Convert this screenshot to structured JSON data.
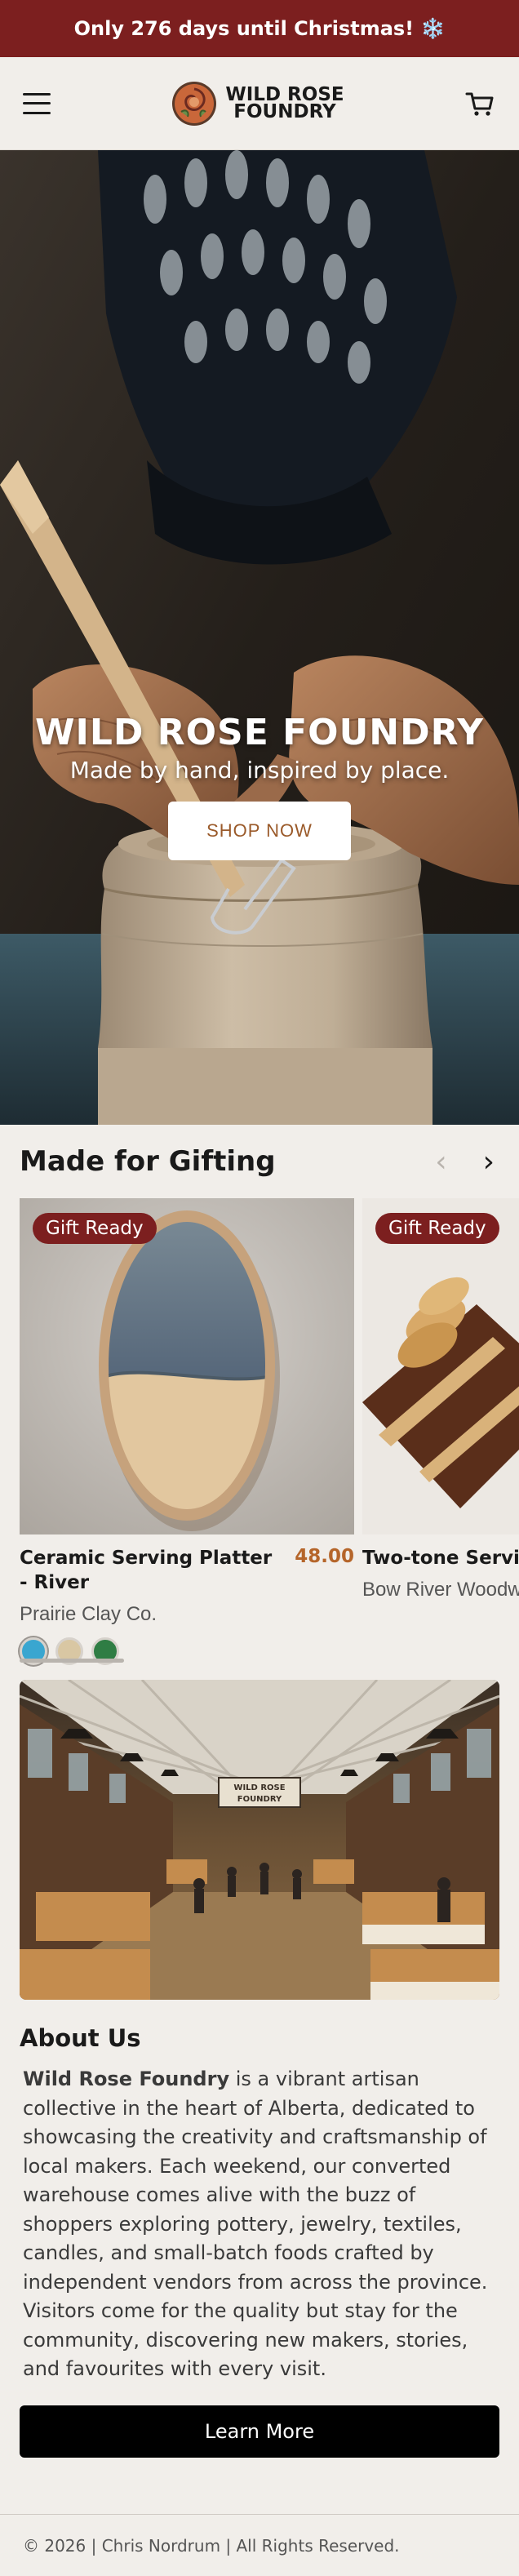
{
  "announcement": {
    "text": "Only 276 days until Christmas! ❄️"
  },
  "header": {
    "logo_line1": "WILD ROSE",
    "logo_line2": "FOUNDRY"
  },
  "hero": {
    "title": "WILD ROSE FOUNDRY",
    "subtitle": "Made by hand, inspired by place.",
    "cta": "SHOP NOW"
  },
  "gifting": {
    "title": "Made for Gifting",
    "products": [
      {
        "badge": "Gift Ready",
        "name": "Ceramic Serving Platter - River",
        "price": "48.00",
        "vendor": "Prairie Clay Co.",
        "swatches": [
          "#3aa6d0",
          "#d9c7a3",
          "#2f7d44"
        ]
      },
      {
        "badge": "Gift Ready",
        "name": "Two-tone Serving Board",
        "price": "",
        "vendor": "Bow River Woodworks"
      }
    ]
  },
  "market_image": {
    "sign_line1": "WILD ROSE",
    "sign_line2": "FOUNDRY"
  },
  "about": {
    "title": "About Us",
    "brand": "Wild Rose Foundry",
    "body": " is a vibrant artisan collective in the heart of Alberta, dedicated to showcasing the creativity and craftsmanship of local makers. Each weekend, our converted warehouse comes alive with the buzz of shoppers exploring pottery, jewelry, textiles, candles, and small-batch foods crafted by independent vendors from across the province. Visitors come for the quality but stay for the community, discovering new makers, stories, and favourites with every visit.",
    "cta": "Learn More"
  },
  "footer": {
    "text": "© 2026 | Chris Nordrum | All Rights Reserved."
  },
  "colors": {
    "accent": "#7c1f1f",
    "price": "#b5652a",
    "background": "#f1eeea"
  }
}
